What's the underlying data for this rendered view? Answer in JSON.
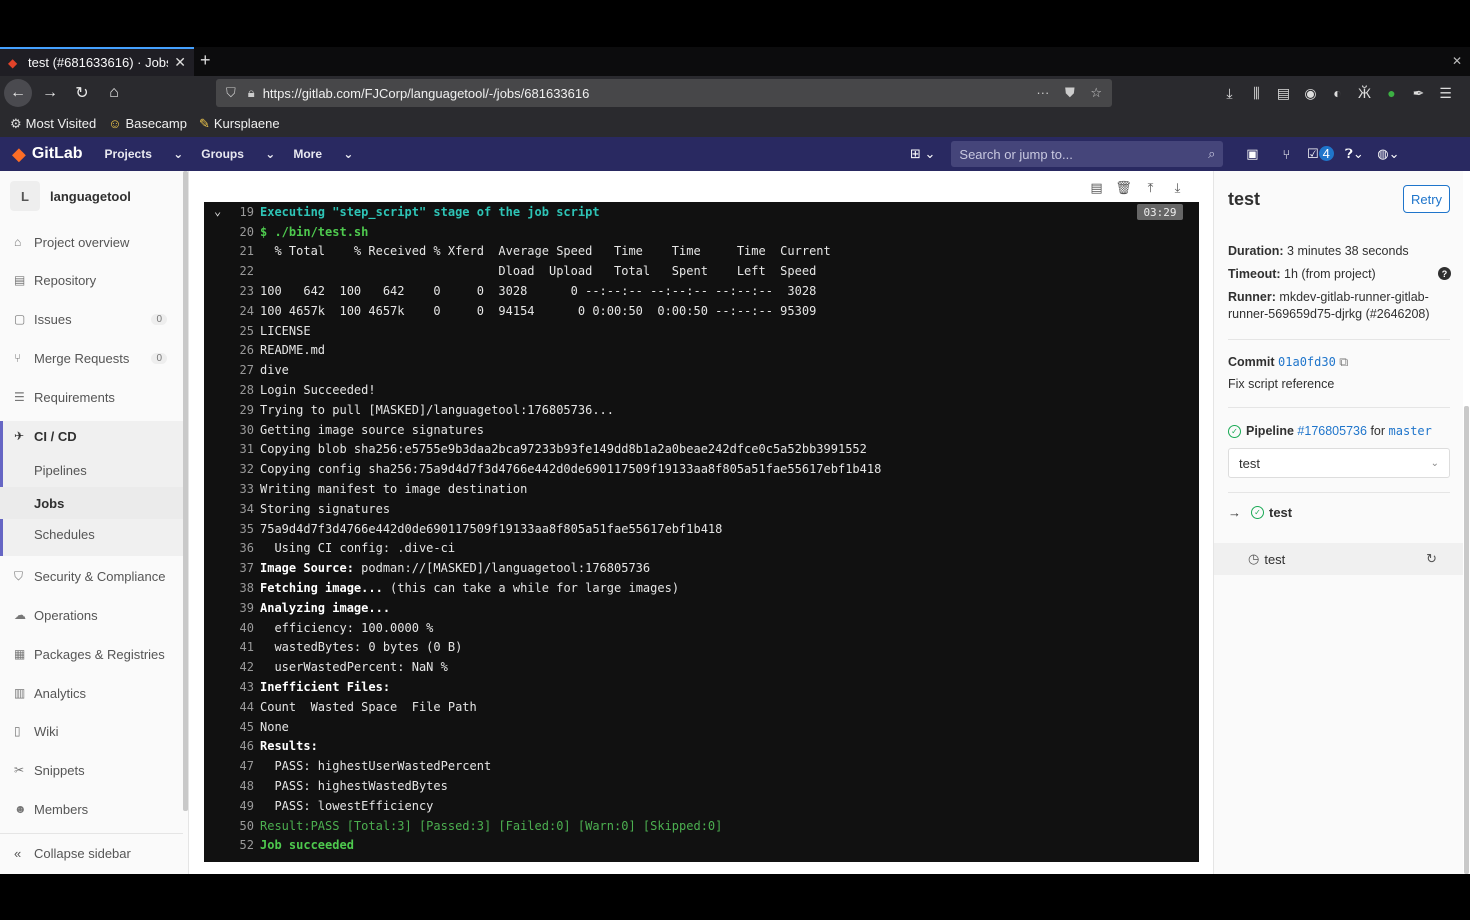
{
  "browser": {
    "tab_title": "test (#681633616) · Jobs",
    "url": "https://gitlab.com/FJCorp/languagetool/-/jobs/681633616",
    "bookmarks": [
      {
        "label": "Most Visited",
        "icon": "gear-icon"
      },
      {
        "label": "Basecamp",
        "icon": "basecamp-icon"
      },
      {
        "label": "Kursplaene",
        "icon": "kursplaene-icon"
      }
    ]
  },
  "gitlab": {
    "brand": "GitLab",
    "menu": {
      "projects": "Projects",
      "groups": "Groups",
      "more": "More"
    },
    "search_placeholder": "Search or jump to...",
    "todo_count": "4"
  },
  "sidebar": {
    "project_initial": "L",
    "project_name": "languagetool",
    "items": {
      "overview": "Project overview",
      "repository": "Repository",
      "issues": "Issues",
      "issues_count": "0",
      "merge_requests": "Merge Requests",
      "merge_requests_count": "0",
      "requirements": "Requirements",
      "cicd": "CI / CD",
      "pipelines": "Pipelines",
      "jobs": "Jobs",
      "schedules": "Schedules",
      "security": "Security & Compliance",
      "operations": "Operations",
      "packages": "Packages & Registries",
      "analytics": "Analytics",
      "wiki": "Wiki",
      "snippets": "Snippets",
      "members": "Members"
    },
    "collapse": "Collapse sidebar"
  },
  "log": {
    "timer": "03:29",
    "lines": [
      {
        "n": "19",
        "t": "Executing \"step_script\" stage of the job script",
        "s": "cyan"
      },
      {
        "n": "20",
        "t": "$ ./bin/test.sh",
        "s": "green"
      },
      {
        "n": "21",
        "t": "  % Total    % Received % Xferd  Average Speed   Time    Time     Time  Current",
        "s": ""
      },
      {
        "n": "22",
        "t": "                                 Dload  Upload   Total   Spent    Left  Speed",
        "s": ""
      },
      {
        "n": "23",
        "t": "100   642  100   642    0     0  3028      0 --:--:-- --:--:-- --:--:--  3028",
        "s": ""
      },
      {
        "n": "24",
        "t": "100 4657k  100 4657k    0     0  94154      0 0:00:50  0:00:50 --:--:-- 95309",
        "s": ""
      },
      {
        "n": "25",
        "t": "LICENSE",
        "s": ""
      },
      {
        "n": "26",
        "t": "README.md",
        "s": ""
      },
      {
        "n": "27",
        "t": "dive",
        "s": ""
      },
      {
        "n": "28",
        "t": "Login Succeeded!",
        "s": ""
      },
      {
        "n": "29",
        "t": "Trying to pull [MASKED]/languagetool:176805736...",
        "s": ""
      },
      {
        "n": "30",
        "t": "Getting image source signatures",
        "s": ""
      },
      {
        "n": "31",
        "t": "Copying blob sha256:e5755e9b3daa2bca97233b93fe149dd8b1a2a0beae242dfce0c5a52bb3991552",
        "s": ""
      },
      {
        "n": "32",
        "t": "Copying config sha256:75a9d4d7f3d4766e442d0de690117509f19133aa8f805a51fae55617ebf1b418",
        "s": ""
      },
      {
        "n": "33",
        "t": "Writing manifest to image destination",
        "s": ""
      },
      {
        "n": "34",
        "t": "Storing signatures",
        "s": ""
      },
      {
        "n": "35",
        "t": "75a9d4d7f3d4766e442d0de690117509f19133aa8f805a51fae55617ebf1b418",
        "s": ""
      },
      {
        "n": "36",
        "t": "  Using CI config: .dive-ci",
        "s": ""
      },
      {
        "n": "37",
        "t": "Image Source:",
        "rest": " podman://[MASKED]/languagetool:176805736",
        "s": "boldprefix"
      },
      {
        "n": "38",
        "t": "Fetching image...",
        "rest": " (this can take a while for large images)",
        "s": "boldprefix"
      },
      {
        "n": "39",
        "t": "Analyzing image...",
        "s": "bold"
      },
      {
        "n": "40",
        "t": "  efficiency: 100.0000 %",
        "s": ""
      },
      {
        "n": "41",
        "t": "  wastedBytes: 0 bytes (0 B)",
        "s": ""
      },
      {
        "n": "42",
        "t": "  userWastedPercent: NaN %",
        "s": ""
      },
      {
        "n": "43",
        "t": "Inefficient Files:",
        "s": "bold"
      },
      {
        "n": "44",
        "t": "Count  Wasted Space  File Path",
        "s": ""
      },
      {
        "n": "45",
        "t": "None",
        "s": ""
      },
      {
        "n": "46",
        "t": "Results:",
        "s": "bold"
      },
      {
        "n": "47",
        "t": "  PASS: highestUserWastedPercent",
        "s": ""
      },
      {
        "n": "48",
        "t": "  PASS: highestWastedBytes",
        "s": ""
      },
      {
        "n": "49",
        "t": "  PASS: lowestEfficiency",
        "s": ""
      },
      {
        "n": "50",
        "t": "Result:PASS [Total:3] [Passed:3] [Failed:0] [Warn:0] [Skipped:0]",
        "s": "greenlight"
      },
      {
        "n": "52",
        "t": "Job succeeded",
        "s": "green"
      }
    ]
  },
  "job": {
    "title": "test",
    "retry": "Retry",
    "duration_label": "Duration:",
    "duration": "3 minutes 38 seconds",
    "timeout_label": "Timeout:",
    "timeout": "1h (from project)",
    "runner_label": "Runner:",
    "runner_line1": "mkdev-gitlab-runner-gitlab-",
    "runner_line2": "runner-569659d75-djrkg (#2646208)",
    "commit_label": "Commit",
    "commit_sha": "01a0fd30",
    "commit_message": "Fix script reference",
    "pipeline_label": "Pipeline",
    "pipeline_id": "#176805736",
    "pipeline_for": "for",
    "branch": "master",
    "stage_select": "test",
    "stage_name": "test",
    "job_name": "test"
  }
}
